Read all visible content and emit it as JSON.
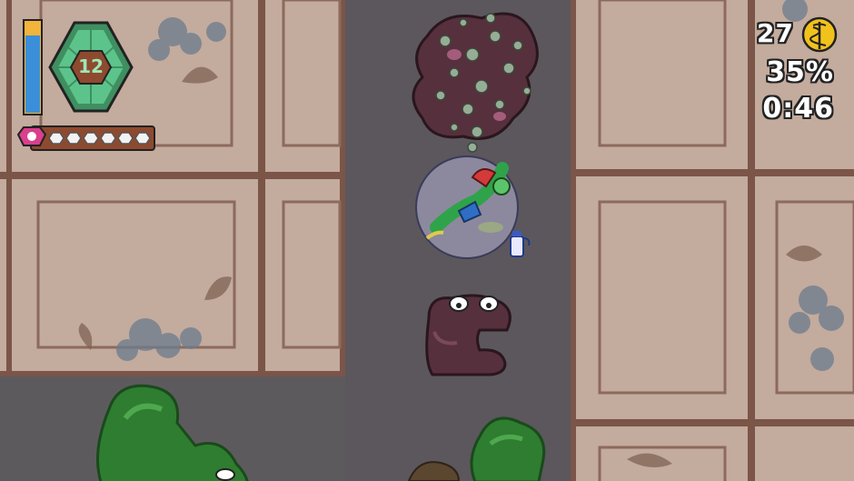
{
  "hud": {
    "level": "12",
    "coins": "27",
    "coin_icon": "caduceus-coin-icon",
    "progress_percent": "35%",
    "timer": "0:46",
    "health_fraction": 0.85,
    "charge_segments_total": 6,
    "charge_segments_filled": 0
  },
  "colors": {
    "street": "#5d5a5e",
    "lane_center": "#5b575d",
    "floor_tile": "#c3ab9d",
    "floor_line": "#7a5548",
    "health_bar": "#3b8fd8",
    "health_bar_base": "#f2b43a",
    "hex_badge": "#3f8f61",
    "hex_badge_inner": "#8d4a2f",
    "charge_bar": "#8d4a2f",
    "pink_gem": "#d93f8c",
    "enemy_blob": "#56303d",
    "green_slime": "#2f7d30",
    "bubble": "#c7c7f0",
    "coin": "#f1c21b"
  },
  "entities": {
    "player": "lizard-in-bubble",
    "enemies": [
      "bubbling-dark-blob",
      "dark-blob-monster"
    ],
    "pickup": "bottle-pickup",
    "hazards": [
      "green-slime"
    ]
  }
}
